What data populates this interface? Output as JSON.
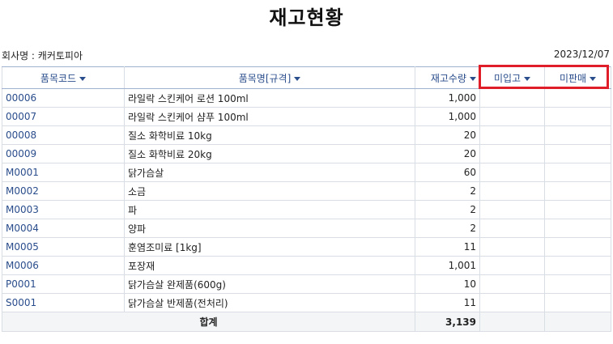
{
  "page": {
    "title": "재고현황",
    "company_label": "회사명 : 캐커토피아",
    "date": "2023/12/07"
  },
  "table": {
    "columns": [
      "품목코드",
      "품목명[규격]",
      "재고수량",
      "미입고",
      "미판매"
    ],
    "rows": [
      {
        "code": "00006",
        "name": "라일락 스킨케어 로션 100ml",
        "qty": "1,000",
        "unreceived": "",
        "unsold": ""
      },
      {
        "code": "00007",
        "name": "라일락 스킨케어 샴푸 100ml",
        "qty": "1,000",
        "unreceived": "",
        "unsold": ""
      },
      {
        "code": "00008",
        "name": "질소 화학비료 10kg",
        "qty": "20",
        "unreceived": "",
        "unsold": ""
      },
      {
        "code": "00009",
        "name": "질소 화학비료 20kg",
        "qty": "20",
        "unreceived": "",
        "unsold": ""
      },
      {
        "code": "M0001",
        "name": "닭가슴살",
        "qty": "60",
        "unreceived": "",
        "unsold": ""
      },
      {
        "code": "M0002",
        "name": "소금",
        "qty": "2",
        "unreceived": "",
        "unsold": ""
      },
      {
        "code": "M0003",
        "name": "파",
        "qty": "2",
        "unreceived": "",
        "unsold": ""
      },
      {
        "code": "M0004",
        "name": "양파",
        "qty": "2",
        "unreceived": "",
        "unsold": ""
      },
      {
        "code": "M0005",
        "name": "훈염조미료 [1kg]",
        "qty": "11",
        "unreceived": "",
        "unsold": ""
      },
      {
        "code": "M0006",
        "name": "포장재",
        "qty": "1,001",
        "unreceived": "",
        "unsold": ""
      },
      {
        "code": "P0001",
        "name": "닭가슴살 완제품(600g)",
        "qty": "10",
        "unreceived": "",
        "unsold": ""
      },
      {
        "code": "S0001",
        "name": "닭가슴살 반제품(전처리)",
        "qty": "11",
        "unreceived": "",
        "unsold": ""
      }
    ],
    "total": {
      "label": "합계",
      "qty": "3,139",
      "unreceived": "",
      "unsold": ""
    }
  },
  "colors": {
    "header_text": "#2a4d8c",
    "highlight_border": "#e01e2a",
    "total_row_bg": "#f4f5f7"
  },
  "icons": {
    "sort": "caret-down-icon"
  }
}
